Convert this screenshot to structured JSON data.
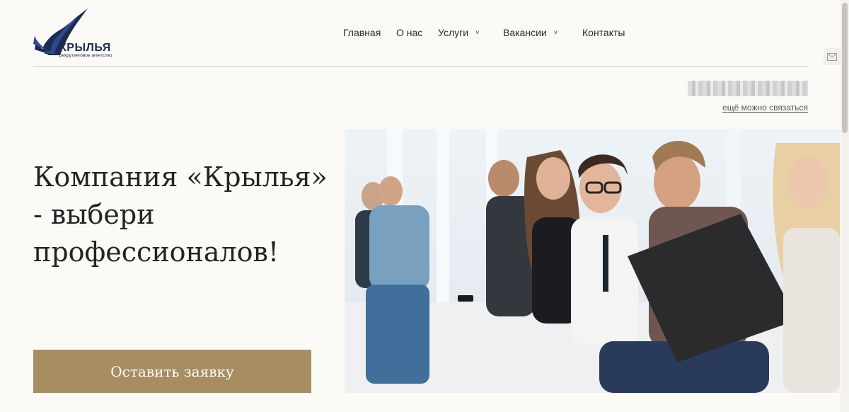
{
  "logo": {
    "brand": "КРЫЛЬЯ",
    "tagline": "рекрутинговое агентство"
  },
  "nav": {
    "items": [
      {
        "label": "Главная"
      },
      {
        "label": "О нас"
      },
      {
        "label": "Услуги",
        "chevron": "˅"
      },
      {
        "label": "Вакансии",
        "chevron": "˅"
      },
      {
        "label": "Контакты"
      }
    ]
  },
  "contact": {
    "link_text": "ещё можно связаться"
  },
  "hero": {
    "title": "Компания «Крылья» - выбери профессионалов!",
    "cta_label": "Оставить заявку",
    "image_icon": "office-people-photo"
  },
  "icons": {
    "mail": "mail-icon"
  },
  "colors": {
    "accent": "#a88d63",
    "brand": "#1d2a52",
    "background": "#fcfaf6"
  }
}
